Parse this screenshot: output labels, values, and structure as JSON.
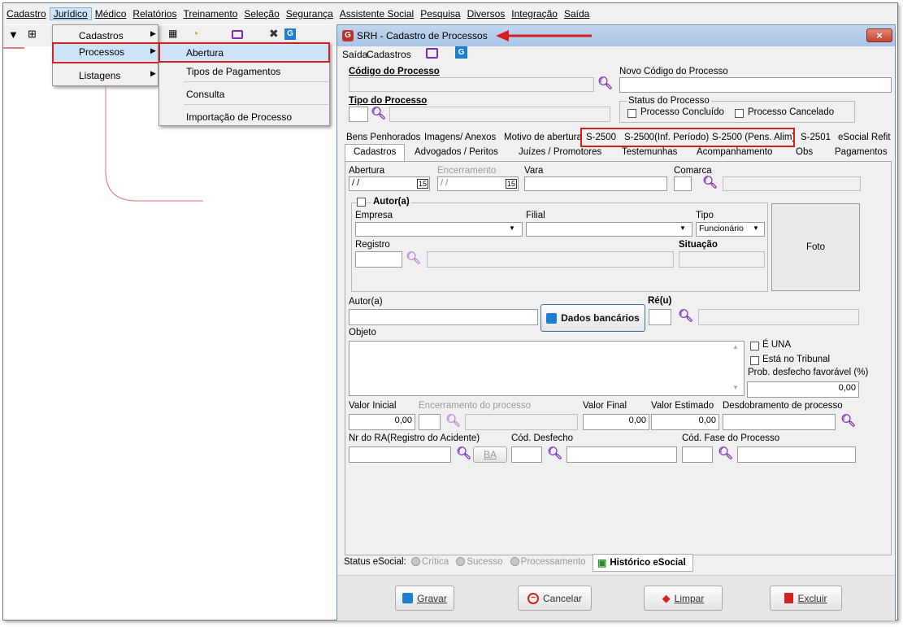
{
  "menubar": [
    "Cadastro",
    "Jurídico",
    "Médico",
    "Relatórios",
    "Treinamento",
    "Seleção",
    "Segurança",
    "Assistente Social",
    "Pesquisa",
    "Diversos",
    "Integração",
    "Saída"
  ],
  "menu1": {
    "items": [
      "Cadastros",
      "Processos",
      "Listagens"
    ]
  },
  "menu2": {
    "items": [
      "Abertura",
      "Tipos de Pagamentos",
      "Consulta",
      "Importação de Processo"
    ]
  },
  "window": {
    "title": "SRH - Cadastro de Processos",
    "close": "×"
  },
  "wintoolbar": {
    "saida": "Saída",
    "cadastros": "Cadastros"
  },
  "fields": {
    "codigo_processo": "Código do Processo",
    "novo_codigo": "Novo Código do Processo",
    "tipo_processo": "Tipo do Processo",
    "status_processo": "Status do Processo",
    "concluido": "Processo Concluído",
    "cancelado": "Processo Cancelado"
  },
  "tabs1": [
    "Bens Penhorados",
    "Imagens/ Anexos",
    "Motivo de abertura",
    "S-2500",
    "S-2500(Inf. Período)",
    "S-2500 (Pens. Alim)",
    "S-2501",
    "eSocial Refit"
  ],
  "tabs2": [
    "Cadastros",
    "Advogados / Peritos",
    "Juízes / Promotores",
    "Testemunhas",
    "Acompanhamento",
    "Obs",
    "Pagamentos"
  ],
  "form": {
    "abertura": "Abertura",
    "abertura_val": "/ /",
    "encerramento": "Encerramento",
    "encerramento_val": "/ /",
    "vara": "Vara",
    "comarca": "Comarca",
    "autor_group": "Autor(a)",
    "empresa": "Empresa",
    "filial": "Filial",
    "tipo": "Tipo",
    "tipo_val": "Funcionário",
    "registro": "Registro",
    "situacao": "Situação",
    "foto": "Foto",
    "autor": "Autor(a)",
    "reu": "Ré(u)",
    "dados_bancarios": "Dados bancários",
    "objeto": "Objeto",
    "e_una": "É UNA",
    "esta_tribunal": "Está no Tribunal",
    "prob_desfecho": "Prob. desfecho favorável (%)",
    "prob_val": "0,00",
    "valor_inicial": "Valor Inicial",
    "valor_inicial_val": "0,00",
    "enc_processo": "Encerramento do processo",
    "valor_final": "Valor Final",
    "valor_final_val": "0,00",
    "valor_estimado": "Valor Estimado",
    "valor_estimado_val": "0,00",
    "desdobramento": "Desdobramento de processo",
    "nr_ra": "Nr do RA(Registro do Acidente)",
    "ba": "BA",
    "cod_desfecho": "Cód. Desfecho",
    "cod_fase": "Cód. Fase do Processo"
  },
  "status": {
    "label": "Status eSocial:",
    "critica": "Crítica",
    "sucesso": "Sucesso",
    "processamento": "Processamento",
    "historico": "Histórico eSocial"
  },
  "buttons": {
    "gravar": "Gravar",
    "cancelar": "Cancelar",
    "limpar": "Limpar",
    "excluir": "Excluir"
  },
  "colors": {
    "highlight": "#d42020",
    "accent": "#1d7fd1",
    "magnifier": "#7a2bb8"
  }
}
